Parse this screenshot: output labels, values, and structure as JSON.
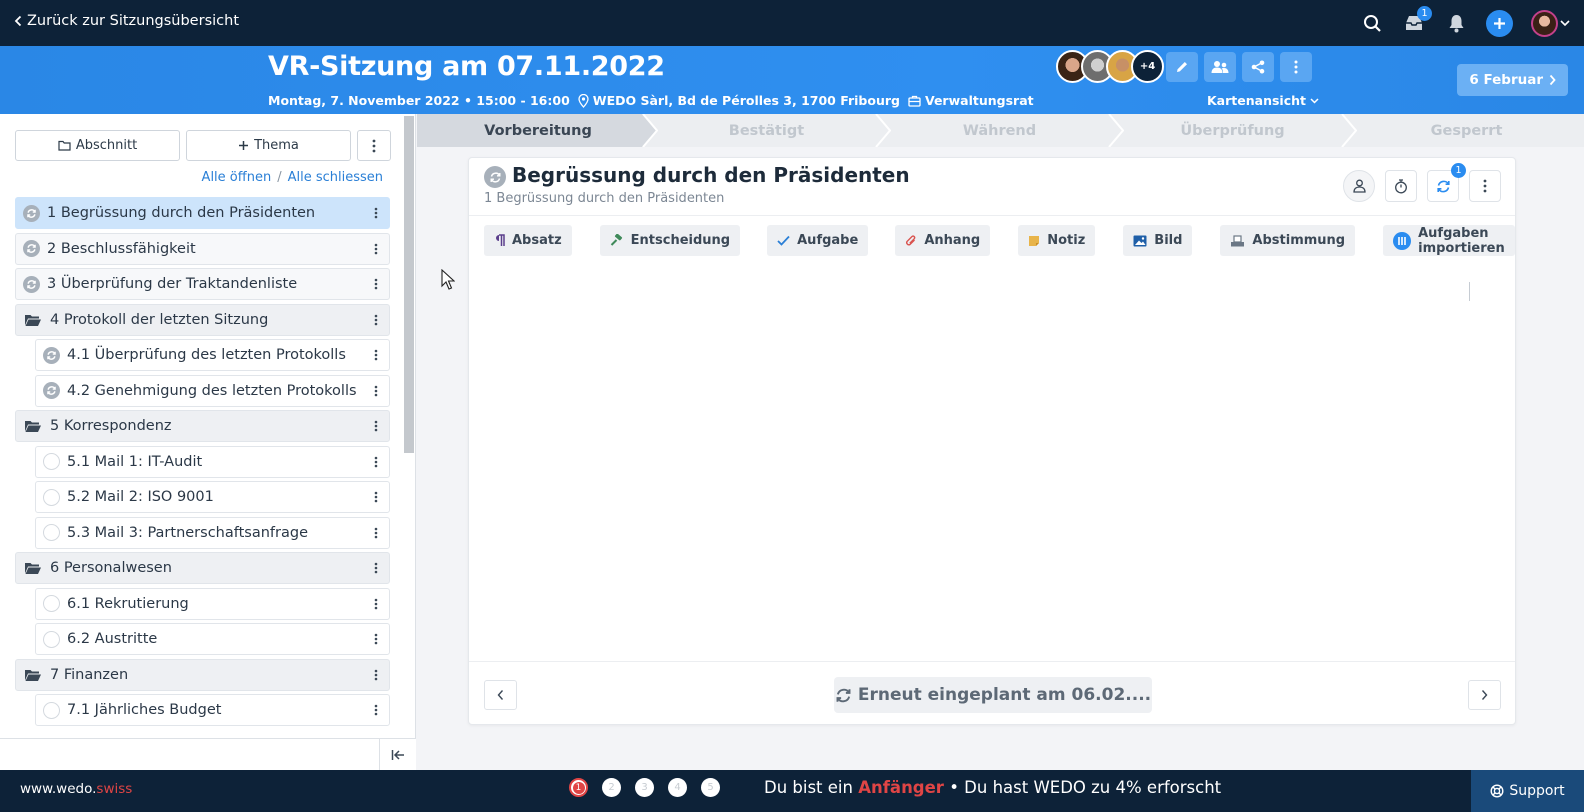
{
  "topbar": {
    "back_label": "Zurück zur Sitzungsübersicht",
    "inbox_badge": "1"
  },
  "header": {
    "title": "VR-Sitzung am 07.11.2022",
    "date_time": "Montag, 7. November 2022 • 15:00 - 16:00",
    "location": "WEDO Sàrl, Bd de Pérolles 3, 1700 Fribourg",
    "committee": "Verwaltungsrat",
    "more_participants": "+4",
    "view_label": "Kartenansicht",
    "next_meeting": "6 Februar"
  },
  "sidebar": {
    "section_button": "Abschnitt",
    "topic_button": "Thema",
    "open_all": "Alle öffnen",
    "separator": "/",
    "close_all": "Alle schliessen",
    "items": [
      {
        "label": "1 Begrüssung durch den Präsidenten",
        "kind": "topic",
        "state": "active"
      },
      {
        "label": "2 Beschlussfähigkeit",
        "kind": "topic"
      },
      {
        "label": "3 Überprüfung der Traktandenliste",
        "kind": "topic"
      },
      {
        "label": "4 Protokoll der letzten Sitzung",
        "kind": "folder"
      },
      {
        "label": "4.1 Überprüfung des letzten Protokolls",
        "kind": "sub-topic"
      },
      {
        "label": "4.2 Genehmigung des letzten Protokolls",
        "kind": "sub-topic"
      },
      {
        "label": "5 Korrespondenz",
        "kind": "folder"
      },
      {
        "label": "5.1 Mail 1: IT-Audit",
        "kind": "sub-empty"
      },
      {
        "label": "5.2 Mail 2: ISO 9001",
        "kind": "sub-empty"
      },
      {
        "label": "5.3 Mail 3: Partnerschaftsanfrage",
        "kind": "sub-empty"
      },
      {
        "label": "6 Personalwesen",
        "kind": "folder"
      },
      {
        "label": "6.1 Rekrutierung",
        "kind": "sub-empty"
      },
      {
        "label": "6.2 Austritte",
        "kind": "sub-empty"
      },
      {
        "label": "7 Finanzen",
        "kind": "folder"
      },
      {
        "label": "7.1 Jährliches Budget",
        "kind": "sub-empty"
      }
    ]
  },
  "steps": [
    "Vorbereitung",
    "Bestätigt",
    "Während",
    "Überprüfung",
    "Gesperrt"
  ],
  "active_step": "Vorbereitung",
  "card": {
    "title": "Begrüssung durch den Präsidenten",
    "subtitle": "1 Begrüssung durch den Präsidenten",
    "sync_badge": "1",
    "blocks": [
      {
        "label": "Absatz",
        "icon": "paragraph-icon",
        "color": "#5b3f8c"
      },
      {
        "label": "Entscheidung",
        "icon": "gavel-icon",
        "color": "#3f8a5a"
      },
      {
        "label": "Aufgabe",
        "icon": "check-icon",
        "color": "#2a7fd6"
      },
      {
        "label": "Anhang",
        "icon": "paperclip-icon",
        "color": "#d9534f"
      },
      {
        "label": "Notiz",
        "icon": "note-icon",
        "color": "#e8b44a"
      },
      {
        "label": "Bild",
        "icon": "image-icon",
        "color": "#1f5fa8"
      },
      {
        "label": "Abstimmung",
        "icon": "ballot-icon",
        "color": "#6b7785"
      },
      {
        "label": "Aufgaben importieren",
        "icon": "import-icon",
        "color": "#2a8cf0"
      }
    ],
    "reschedule_label": "Erneut eingeplant am 06.02...."
  },
  "bottombar": {
    "site_main": "www.wedo.",
    "site_accent": "swiss",
    "dots": [
      "1",
      "2",
      "3",
      "4",
      "5"
    ],
    "level_prefix": "Du bist ein",
    "level_name": "Anfänger",
    "level_suffix": "• Du hast WEDO zu 4% erforscht",
    "support_label": "Support"
  },
  "colors": {
    "nav_dark": "#0d2238",
    "header_blue": "#2f8ff0",
    "accent_blue": "#2a8cf0",
    "accent_red": "#e04545",
    "active_row": "#cde4fb"
  }
}
